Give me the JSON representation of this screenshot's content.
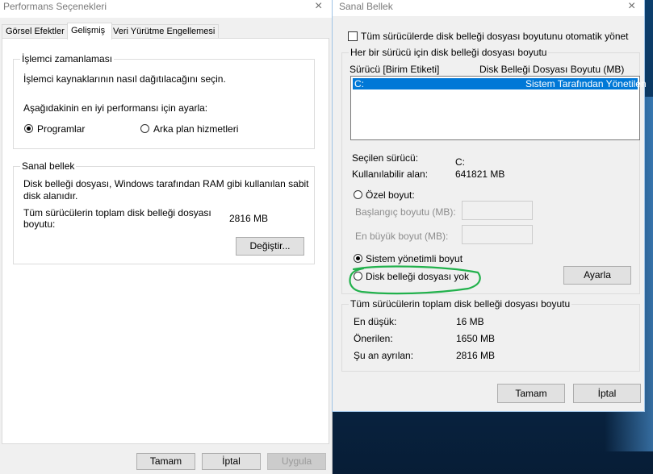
{
  "left_window": {
    "title": "Performans Seçenekleri",
    "close_glyph": "×",
    "tabs": [
      {
        "label": "Görsel Efektler",
        "active": false
      },
      {
        "label": "Gelişmiş",
        "active": true
      },
      {
        "label": "Veri Yürütme Engellemesi",
        "active": false
      }
    ],
    "cpu_group": {
      "title": "İşlemci zamanlaması",
      "description": "İşlemci kaynaklarının nasıl dağıtılacağını seçin.",
      "prompt": "Aşağıdakinin en iyi performansı için ayarla:",
      "options": [
        {
          "label": "Programlar",
          "checked": true
        },
        {
          "label": "Arka plan hizmetleri",
          "checked": false
        }
      ]
    },
    "virtual_memory_group": {
      "title": "Sanal bellek",
      "description_line1": "Disk belleği dosyası, Windows tarafından RAM gibi kullanılan sabit",
      "description_line2": "disk alanıdır.",
      "total_label_line1": "Tüm sürücülerin toplam disk belleği dosyası",
      "total_label_line2": "boyutu:",
      "total_value": "2816 MB",
      "change_button": "Değiştir..."
    },
    "footer_buttons": {
      "ok": "Tamam",
      "cancel": "İptal",
      "apply": "Uygula"
    }
  },
  "right_window": {
    "title": "Sanal Bellek",
    "close_glyph": "×",
    "auto_manage_label": "Tüm sürücülerde disk belleği dosyası boyutunu otomatik yönet",
    "auto_manage_checked": false,
    "per_drive_group": {
      "title": "Her bir sürücü için disk belleği dosyası boyutu",
      "col_drive": "Sürücü  [Birim Etiketi]",
      "col_size": "Disk Belleği Dosyası Boyutu (MB)",
      "rows": [
        {
          "drive": "C:",
          "size": "Sistem Tarafından Yönetilen",
          "selected": true
        }
      ],
      "selected_drive_label": "Seçilen sürücü:",
      "selected_drive_value": "C:",
      "available_space_label": "Kullanılabilir alan:",
      "available_space_value": "641821 MB",
      "custom_size_label": "Özel boyut:",
      "initial_size_label": "Başlangıç boyutu (MB):",
      "max_size_label": "En büyük boyut (MB):",
      "initial_size_value": "",
      "max_size_value": "",
      "system_managed_label": "Sistem yönetimli boyut",
      "no_paging_label": "Disk belleği dosyası yok",
      "selected_option": "system_managed",
      "set_button": "Ayarla"
    },
    "total_group": {
      "title": "Tüm sürücülerin toplam disk belleği dosyası boyutu",
      "minimum_label": "En düşük:",
      "minimum_value": "16 MB",
      "recommended_label": "Önerilen:",
      "recommended_value": "1650 MB",
      "allocated_label": "Şu an ayrılan:",
      "allocated_value": "2816 MB"
    },
    "footer_buttons": {
      "ok": "Tamam",
      "cancel": "İptal"
    }
  },
  "colors": {
    "selection": "#0078d7",
    "annotation": "#22b14c",
    "window_bg": "#f0f0f0",
    "panel_bg": "#ffffff"
  }
}
